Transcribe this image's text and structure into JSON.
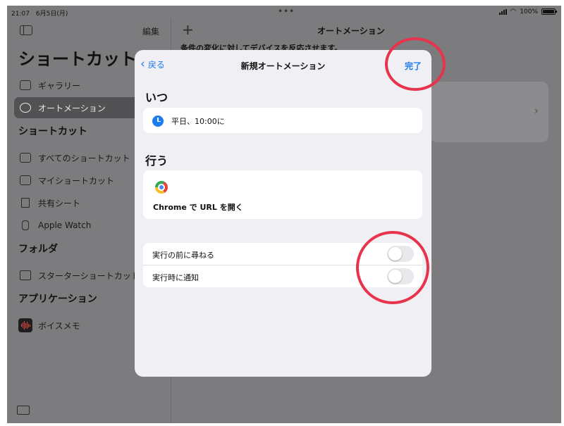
{
  "status_bar": {
    "time": "21:07　6月5日(月)",
    "battery": "100%"
  },
  "sidebar": {
    "edit_label": "編集",
    "big_title": "ショートカット",
    "items_top": [
      {
        "label": "ギャラリー"
      },
      {
        "label": "オートメーション"
      }
    ],
    "section_shortcuts": "ショートカット",
    "items_shortcuts": [
      {
        "label": "すべてのショートカット"
      },
      {
        "label": "マイショートカット"
      },
      {
        "label": "共有シート"
      },
      {
        "label": "Apple Watch"
      }
    ],
    "section_folders": "フォルダ",
    "items_folders": [
      {
        "label": "スターターショートカット"
      }
    ],
    "section_apps": "アプリケーション",
    "items_apps": [
      {
        "label": "ボイスメモ"
      }
    ]
  },
  "main": {
    "title": "オートメーション",
    "description": "条件の変化に対してデバイスを反応させます。"
  },
  "sheet": {
    "back_label": "戻る",
    "title": "新規オートメーション",
    "done_label": "完了",
    "when_header": "いつ",
    "when_value": "平日、10:00に",
    "do_header": "行う",
    "action_label": "Chrome で URL を開く",
    "ask_before_running": {
      "label": "実行の前に尋ねる",
      "on": false
    },
    "notify_when_run": {
      "label": "実行時に通知",
      "on": false
    }
  },
  "colors": {
    "accent": "#1a7cf0",
    "annotation": "#e8334d"
  }
}
